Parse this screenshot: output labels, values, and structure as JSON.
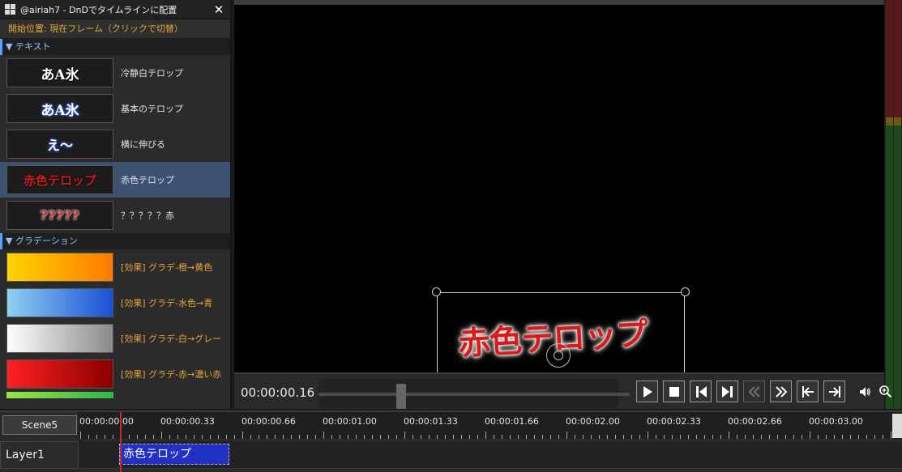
{
  "panel": {
    "title": "@airiah7 - DnDでタイムラインに配置",
    "close": "✕",
    "start_position": "開始位置: 現在フレーム（クリックで切替）",
    "sections": [
      {
        "header": "▼ テキスト",
        "items": [
          {
            "thumb": "あA氷",
            "label": "冷静白テロップ"
          },
          {
            "thumb": "あA氷",
            "label": "基本のテロップ"
          },
          {
            "thumb": "え〜",
            "label": "横に伸びる"
          },
          {
            "thumb": "赤色テロップ",
            "label": "赤色テロップ"
          },
          {
            "thumb": "?????",
            "label": "？？？？？赤"
          }
        ]
      },
      {
        "header": "▼ グラデーション",
        "items": [
          {
            "label": "[効果] グラデ-橙→黄色",
            "gradient": [
              "#ffd400",
              "#ff7a00"
            ]
          },
          {
            "label": "[効果] グラデ-水色→青",
            "gradient": [
              "#8fd1f0",
              "#1a4fd6"
            ]
          },
          {
            "label": "[効果] グラデ-白→グレー",
            "gradient": [
              "#ffffff",
              "#8a8a8a"
            ]
          },
          {
            "label": "[効果] グラデ-赤→濃い赤",
            "gradient": [
              "#ff2020",
              "#8a0000"
            ]
          }
        ]
      }
    ]
  },
  "preview": {
    "telop_text": "赤色テロップ"
  },
  "transport": {
    "time": "00:00:00.16"
  },
  "timeline": {
    "scene": "Scene5",
    "ticks": [
      "00:00:00.00",
      "00:00:00.33",
      "00:00:00.66",
      "00:00:01.00",
      "00:00:01.33",
      "00:00:01.66",
      "00:00:02.00",
      "00:00:02.33",
      "00:00:02.66",
      "00:00:03.00"
    ],
    "layer": "Layer1",
    "clip": "赤色テロップ"
  }
}
